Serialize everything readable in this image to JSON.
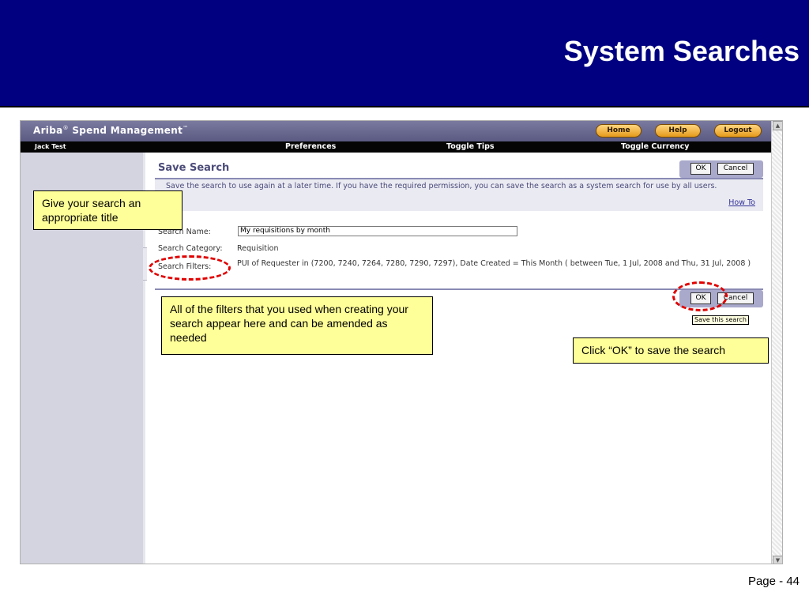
{
  "slide": {
    "title": "System Searches",
    "page": "Page - 44"
  },
  "app": {
    "brand": "Ariba",
    "brand_reg": "®",
    "brand_suffix": "Spend Management",
    "brand_tm": "™",
    "buttons": {
      "home": "Home",
      "help": "Help",
      "logout": "Logout"
    },
    "user": "Jack Test",
    "nav": [
      "Preferences",
      "Toggle Tips",
      "Toggle Currency"
    ]
  },
  "form": {
    "title": "Save Search",
    "ok": "OK",
    "cancel": "Cancel",
    "description": "Save the search to use again at a later time. If you have the required permission, you can save the search as a system search for use by all users.",
    "how_to": "How To",
    "name_label": "Search Name:",
    "name_value": "My requisitions by month",
    "category_label": "Search Category:",
    "category_value": "Requisition",
    "filters_label": "Search Filters:",
    "filters_value": "PUI of Requester in (7200, 7240, 7264, 7280, 7290, 7297), Date Created = This Month ( between Tue, 1 Jul, 2008 and Thu, 31 Jul, 2008 )",
    "tooltip": "Save this search"
  },
  "callouts": {
    "title": "Give your search an appropriate title",
    "filters": "All of the filters that you used when creating your search appear here and can be amended as needed",
    "ok": "Click “OK” to save the search"
  },
  "colors": {
    "header_bg": "#000080",
    "callout_bg": "#ffff99",
    "ring": "#e00000"
  }
}
